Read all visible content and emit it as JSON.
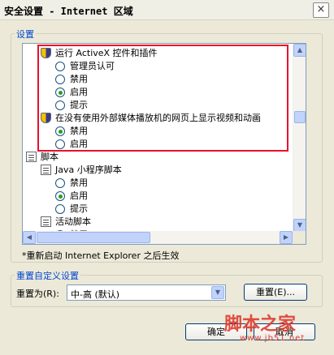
{
  "window": {
    "title": "安全设置 - Internet 区域",
    "close_icon": "×"
  },
  "settings_group": {
    "label": "设置"
  },
  "tree": [
    {
      "type": "shield",
      "label": "运行 ActiveX 控件和插件",
      "indent": 0
    },
    {
      "type": "radio",
      "label": "管理员认可",
      "checked": false,
      "indent": 0
    },
    {
      "type": "radio",
      "label": "禁用",
      "checked": false,
      "indent": 0
    },
    {
      "type": "radio",
      "label": "启用",
      "checked": true,
      "indent": 0
    },
    {
      "type": "radio",
      "label": "提示",
      "checked": false,
      "indent": 0
    },
    {
      "type": "shield",
      "label": "在没有使用外部媒体播放机的网页上显示视频和动画",
      "indent": 0
    },
    {
      "type": "radio",
      "label": "禁用",
      "checked": true,
      "indent": 0
    },
    {
      "type": "radio",
      "label": "启用",
      "checked": false,
      "indent": 0
    },
    {
      "type": "sheet",
      "label": "脚本",
      "indent": -1
    },
    {
      "type": "sheet",
      "label": "Java 小程序脚本",
      "indent": 0
    },
    {
      "type": "radio",
      "label": "禁用",
      "checked": false,
      "indent": 0
    },
    {
      "type": "radio",
      "label": "启用",
      "checked": true,
      "indent": 0
    },
    {
      "type": "radio",
      "label": "提示",
      "checked": false,
      "indent": 0
    },
    {
      "type": "sheet",
      "label": "活动脚本",
      "indent": 0
    },
    {
      "type": "radio",
      "label": "禁用",
      "checked": false,
      "indent": 0
    }
  ],
  "note": "*重新启动 Internet Explorer 之后生效",
  "reset_group": {
    "label": "重置自定义设置",
    "reset_to_label": "重置为(R):",
    "reset_to_value": "中-高 (默认)",
    "reset_button": "重置(E)..."
  },
  "buttons": {
    "ok": "确定",
    "cancel": "取消"
  },
  "watermark": {
    "text": "脚本之家",
    "url": "www.jb51.net"
  },
  "colors": {
    "highlight_box": "#E8102A",
    "group_label": "#0046D5"
  }
}
